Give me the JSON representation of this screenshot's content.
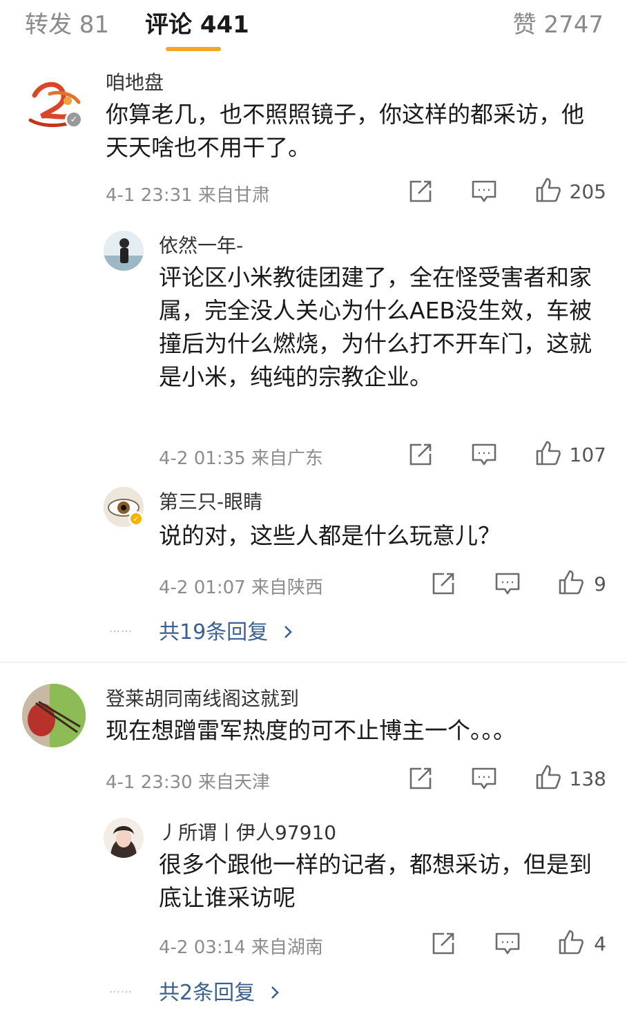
{
  "tabs": {
    "repost": "转发 81",
    "comments": "评论 441",
    "likes": "赞 2747"
  },
  "icons": {
    "share": "share-icon",
    "comment": "comment-icon",
    "like": "thumbs-up-icon",
    "chevron": "chevron-right-icon"
  },
  "accent": "#f5a623",
  "link_color": "#3d5f8f",
  "comments": [
    {
      "user": "咱地盘",
      "text": "你算老几，也不照照镜子，你这样的都采访，他天天啥也不用干了。",
      "time": "4-1 23:31 来自甘肃",
      "likes": "205",
      "replies": [
        {
          "user": "依然一年-",
          "text": "评论区小米教徒团建了，全在怪受害者和家属，完全没人关心为什么AEB没生效，车被撞后为什么燃烧，为什么打不开车门，这就是小米，纯纯的宗教企业。",
          "time": "4-2 01:35 来自广东",
          "likes": "107"
        },
        {
          "user": "第三只-眼睛",
          "text": "说的对，这些人都是什么玩意儿？",
          "time": "4-2 01:07 来自陕西",
          "likes": "9"
        }
      ],
      "more_replies": "共19条回复",
      "more_dots": "……"
    },
    {
      "user": "登莱胡同南线阁这就到",
      "text": "现在想蹭雷军热度的可不止博主一个。。。",
      "time": "4-1 23:30 来自天津",
      "likes": "138",
      "replies": [
        {
          "user": "丿所谓丨伊人97910",
          "text": "很多个跟他一样的记者，都想采访，但是到底让谁采访呢",
          "time": "4-2 03:14 来自湖南",
          "likes": "4"
        }
      ],
      "more_replies": "共2条回复",
      "more_dots": "……"
    }
  ]
}
